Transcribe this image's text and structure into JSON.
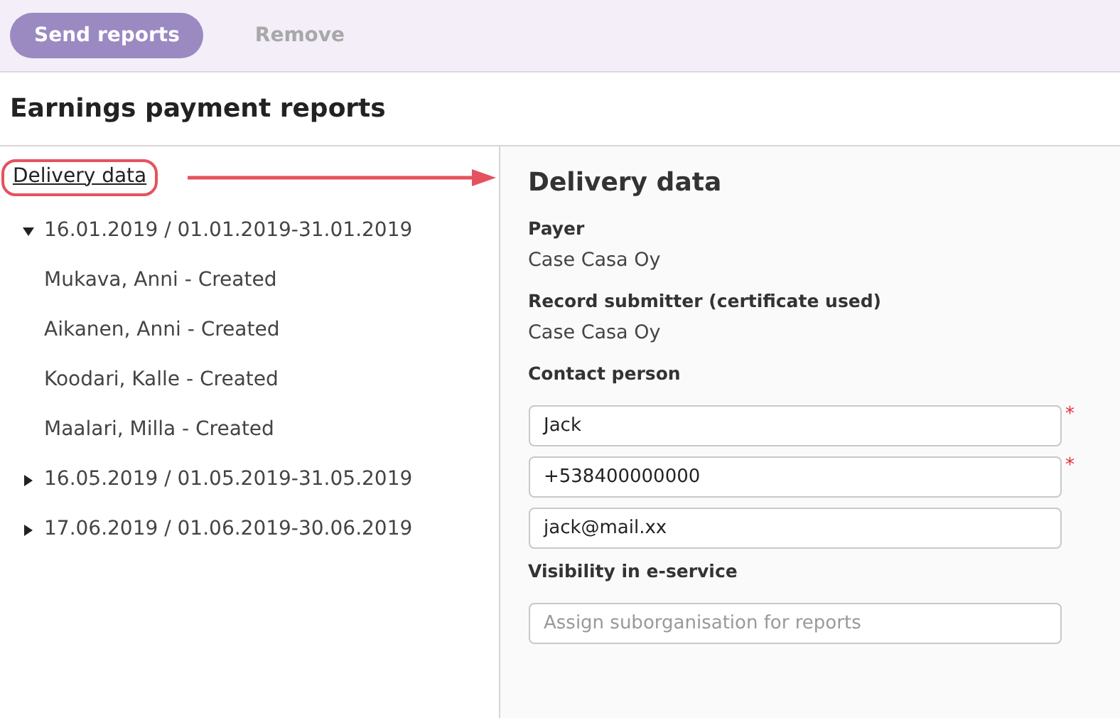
{
  "toolbar": {
    "buttons": [
      {
        "label": "Send reports",
        "disabled": false
      },
      {
        "label": "Remove",
        "disabled": true
      }
    ]
  },
  "page_title": "Earnings payment reports",
  "sidebar": {
    "link": "Delivery data",
    "groups": [
      {
        "label": "16.01.2019 / 01.01.2019-31.01.2019",
        "expanded": true,
        "children": [
          {
            "label": "Mukava, Anni - Created"
          },
          {
            "label": "Aikanen, Anni - Created"
          },
          {
            "label": "Koodari, Kalle - Created"
          },
          {
            "label": "Maalari, Milla - Created"
          }
        ]
      },
      {
        "label": "16.05.2019 / 01.05.2019-31.05.2019",
        "expanded": false
      },
      {
        "label": "17.06.2019 / 01.06.2019-30.06.2019",
        "expanded": false
      }
    ]
  },
  "details": {
    "title": "Delivery data",
    "fields": [
      {
        "kind": "static",
        "label": "Payer",
        "value": "Case Casa Oy"
      },
      {
        "kind": "static",
        "label": "Record submitter (certificate used)",
        "value": "Case Casa Oy"
      },
      {
        "kind": "heading",
        "label": "Contact person"
      },
      {
        "kind": "input",
        "value": "Jack",
        "required_mark": "*"
      },
      {
        "kind": "input",
        "value": "+538400000000",
        "required_mark": "*"
      },
      {
        "kind": "input",
        "value": "jack@mail.xx"
      },
      {
        "kind": "heading",
        "label": "Visibility in e-service"
      },
      {
        "kind": "input",
        "placeholder": "Assign suborganisation for reports"
      }
    ]
  }
}
